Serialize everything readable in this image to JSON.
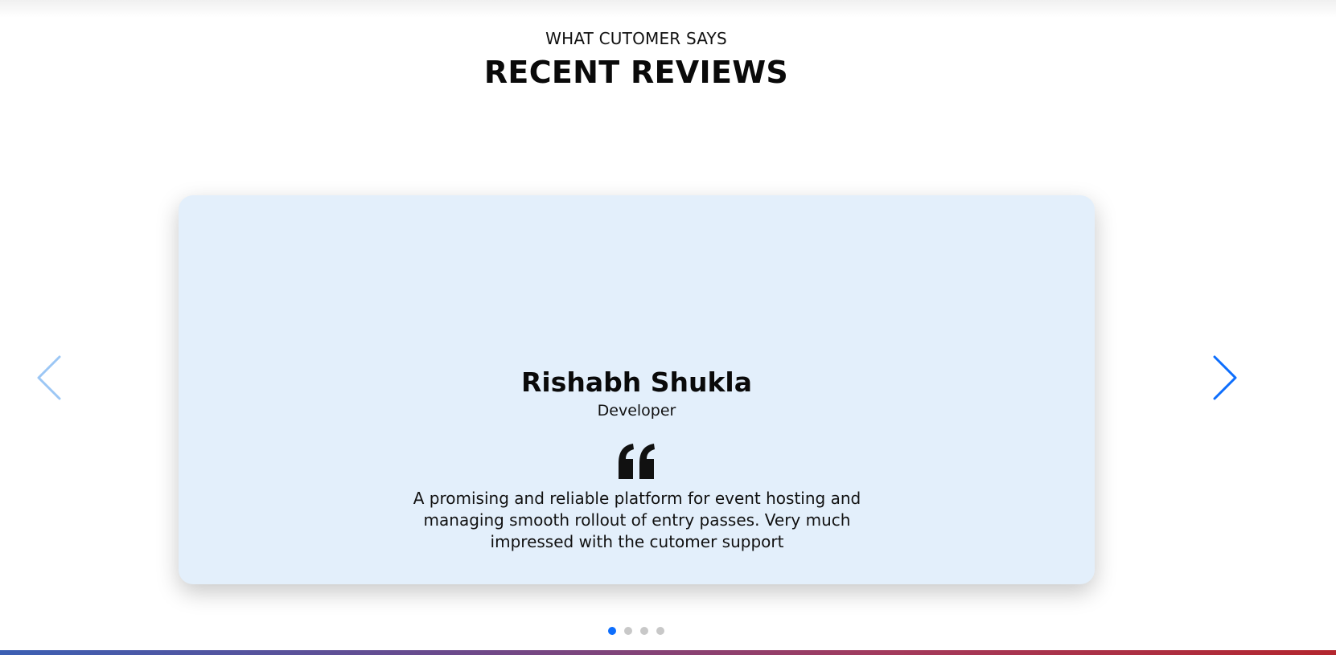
{
  "section": {
    "eyebrow": "WHAT CUTOMER SAYS",
    "title": "RECENT REVIEWS"
  },
  "review": {
    "name": "Rishabh Shukla",
    "role": "Developer",
    "quote_icon": "quote-left-icon",
    "text": "A promising and reliable platform for event hosting and managing smooth rollout of entry passes. Very much impressed with the cutomer support"
  },
  "navigation": {
    "prev_icon": "chevron-left-icon",
    "next_icon": "chevron-right-icon"
  },
  "pagination": {
    "total": 4,
    "active_index": 0
  },
  "colors": {
    "accent": "#0d6efd",
    "card_background": "#e3effb",
    "dot_inactive": "#c8c8c8",
    "prev_arrow": "#9cc7f5"
  }
}
